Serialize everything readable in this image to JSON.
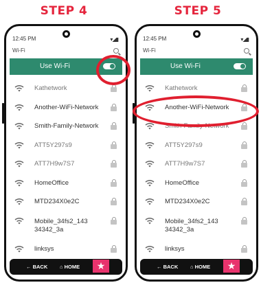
{
  "steps": [
    {
      "title": "STEP 4",
      "status": {
        "time": "12:45 PM",
        "signal": "▾◢▮"
      },
      "header": {
        "title": "Wi-Fi",
        "search_icon": "search-icon"
      },
      "use_wifi": {
        "label": "Use Wi-Fi",
        "on": true
      },
      "networks": [
        {
          "name": "Kathetwork",
          "faded": true
        },
        {
          "name": "Another-WiFi-Network",
          "faded": false
        },
        {
          "name": "Smith-Family-Network",
          "faded": false
        },
        {
          "name": "ATT5Y297s9",
          "faded": true
        },
        {
          "name": "ATT7H9w7S7",
          "faded": true
        },
        {
          "name": "HomeOffice",
          "faded": false
        },
        {
          "name": "MTD234X0e2C",
          "faded": false
        },
        {
          "name": "Mobile_34fs2_143\n34342_3a",
          "faded": false,
          "tall": true
        },
        {
          "name": "linksys",
          "faded": false
        }
      ],
      "nav": {
        "back": "← BACK",
        "home": "⌂ HOME",
        "star": "★"
      }
    },
    {
      "title": "STEP 5",
      "status": {
        "time": "12:45 PM",
        "signal": "▾◢▮"
      },
      "header": {
        "title": "Wi-Fi",
        "search_icon": "search-icon"
      },
      "use_wifi": {
        "label": "Use Wi-Fi",
        "on": true
      },
      "networks": [
        {
          "name": "Kathetwork",
          "faded": true
        },
        {
          "name": "Another-WiFi-Network",
          "faded": false
        },
        {
          "name": "Smith-Family-Network",
          "faded": true
        },
        {
          "name": "ATT5Y297s9",
          "faded": true
        },
        {
          "name": "ATT7H9w7S7",
          "faded": true
        },
        {
          "name": "HomeOffice",
          "faded": false
        },
        {
          "name": "MTD234X0e2C",
          "faded": false
        },
        {
          "name": "Mobile_34fs2_143\n34342_3a",
          "faded": false,
          "tall": true
        },
        {
          "name": "linksys",
          "faded": false
        }
      ],
      "nav": {
        "back": "← BACK",
        "home": "⌂ HOME",
        "star": "★"
      }
    }
  ],
  "colors": {
    "accent_green": "#2e8a6e",
    "highlight_red": "#e01f2f",
    "title_red": "#e5253d",
    "star_pink": "#e8336d"
  }
}
